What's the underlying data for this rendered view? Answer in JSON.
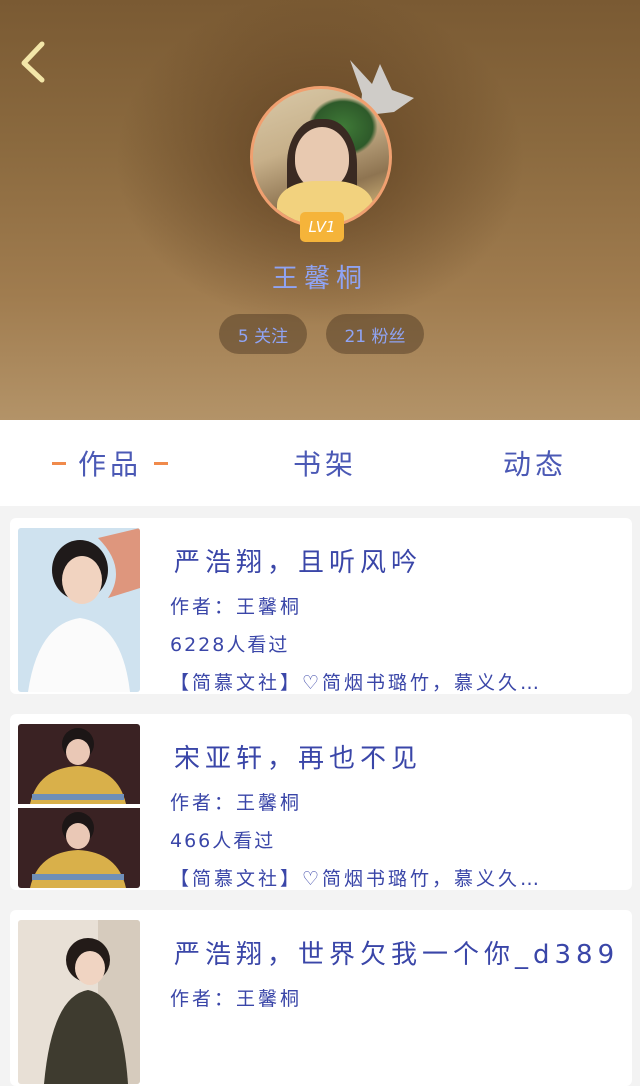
{
  "colors": {
    "accent_text": "#8fa3f3",
    "body_text": "#3a46a8",
    "tab_dash": "#f08a4b",
    "badge": "#f5b43a"
  },
  "header": {
    "back_icon": "chevron-left-icon",
    "crown_icon": "crown-icon",
    "level": "LV1",
    "username": "王馨桐",
    "following": "5 关注",
    "followers": "21 粉丝"
  },
  "tabs": [
    {
      "label": "作品",
      "active": true
    },
    {
      "label": "书架",
      "active": false
    },
    {
      "label": "动态",
      "active": false
    }
  ],
  "works": [
    {
      "title": "严浩翔，且听风吟",
      "author": "作者：王馨桐",
      "views": "6228人看过",
      "desc": "【简慕文社】♡简烟书璐竹，慕义久…"
    },
    {
      "title": "宋亚轩，再也不见",
      "author": "作者：王馨桐",
      "views": "466人看过",
      "desc": "【简慕文社】♡简烟书璐竹，慕义久…"
    },
    {
      "title": "严浩翔，世界欠我一个你_d389",
      "author": "作者：王馨桐",
      "views": "",
      "desc": ""
    }
  ]
}
